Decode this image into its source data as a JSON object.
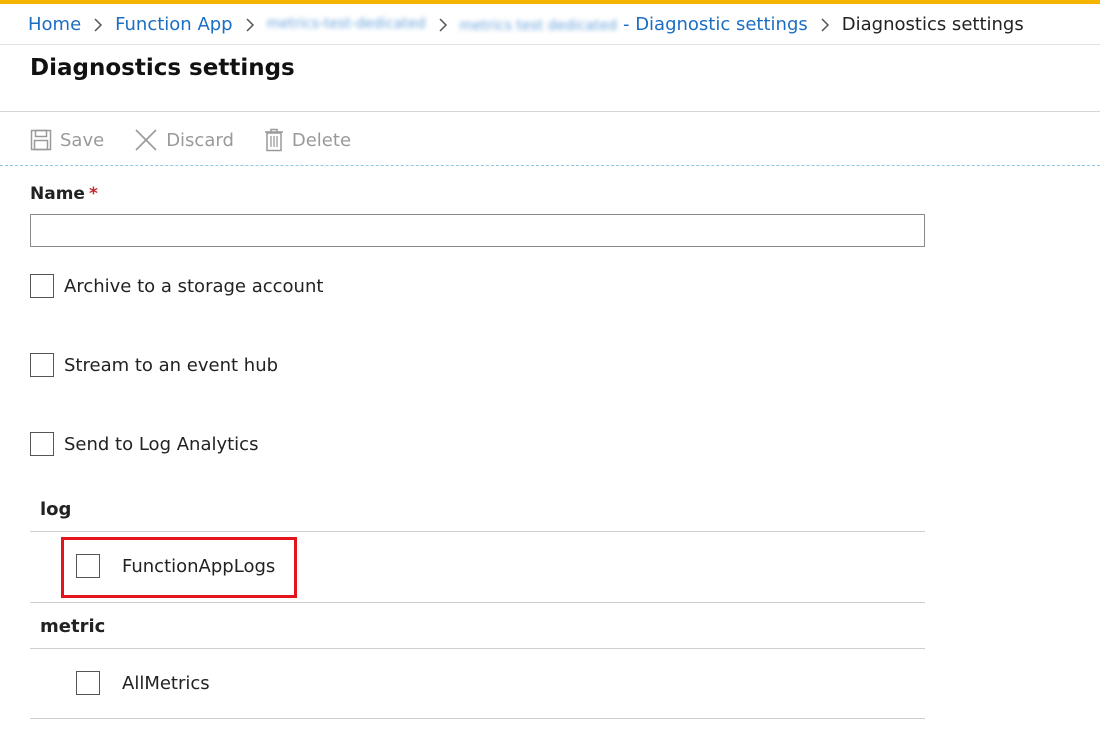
{
  "breadcrumb": {
    "items": [
      {
        "label": "Home"
      },
      {
        "label": "Function App"
      },
      {
        "label": "metrics-test-dedicated"
      },
      {
        "label": "metrics test dedicated"
      }
    ],
    "resource_suffix": " - Diagnostic settings",
    "current": "Diagnostics settings"
  },
  "page": {
    "title": "Diagnostics settings"
  },
  "toolbar": {
    "save_label": "Save",
    "discard_label": "Discard",
    "delete_label": "Delete"
  },
  "form": {
    "name_label": "Name",
    "required_marker": "*",
    "name_value": "",
    "options": {
      "archive_label": "Archive to a storage account",
      "stream_label": "Stream to an event hub",
      "log_analytics_label": "Send to Log Analytics"
    }
  },
  "sections": {
    "log_header": "log",
    "log_category": "FunctionAppLogs",
    "metric_header": "metric",
    "metric_category": "AllMetrics"
  },
  "colors": {
    "accent": "#f5b400",
    "link": "#1b6ec2",
    "highlight": "#e4141d",
    "required": "#c4262e"
  }
}
